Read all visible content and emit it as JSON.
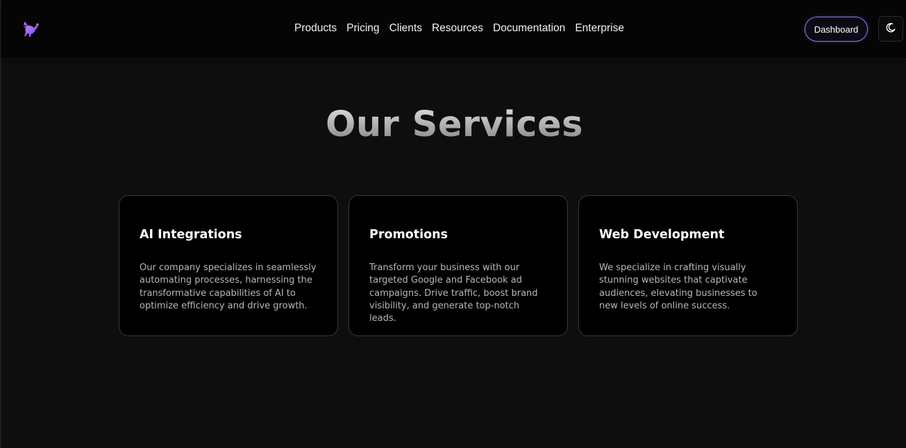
{
  "header": {
    "logo_icon": "pegasus-logo-icon",
    "nav": [
      {
        "label": "Products"
      },
      {
        "label": "Pricing"
      },
      {
        "label": "Clients"
      },
      {
        "label": "Resources"
      },
      {
        "label": "Documentation"
      },
      {
        "label": "Enterprise"
      }
    ],
    "dashboard_label": "Dashboard",
    "theme_toggle_icon": "moon-icon"
  },
  "main": {
    "title": "Our Services",
    "cards": [
      {
        "title": "AI Integrations",
        "description": "Our company specializes in seamlessly automating processes, harnessing the transformative capabilities of AI to optimize efficiency and drive growth."
      },
      {
        "title": "Promotions",
        "description": "Transform your business with our targeted Google and Facebook ad campaigns. Drive traffic, boost brand visibility, and generate top-notch leads."
      },
      {
        "title": "Web Development",
        "description": "We specialize in crafting visually stunning websites that captivate audiences, elevating businesses to new levels of online success."
      }
    ]
  },
  "colors": {
    "background": "#0e0e0e",
    "header_background": "#050505",
    "card_background": "#000000",
    "accent": "#8b7cf0"
  }
}
